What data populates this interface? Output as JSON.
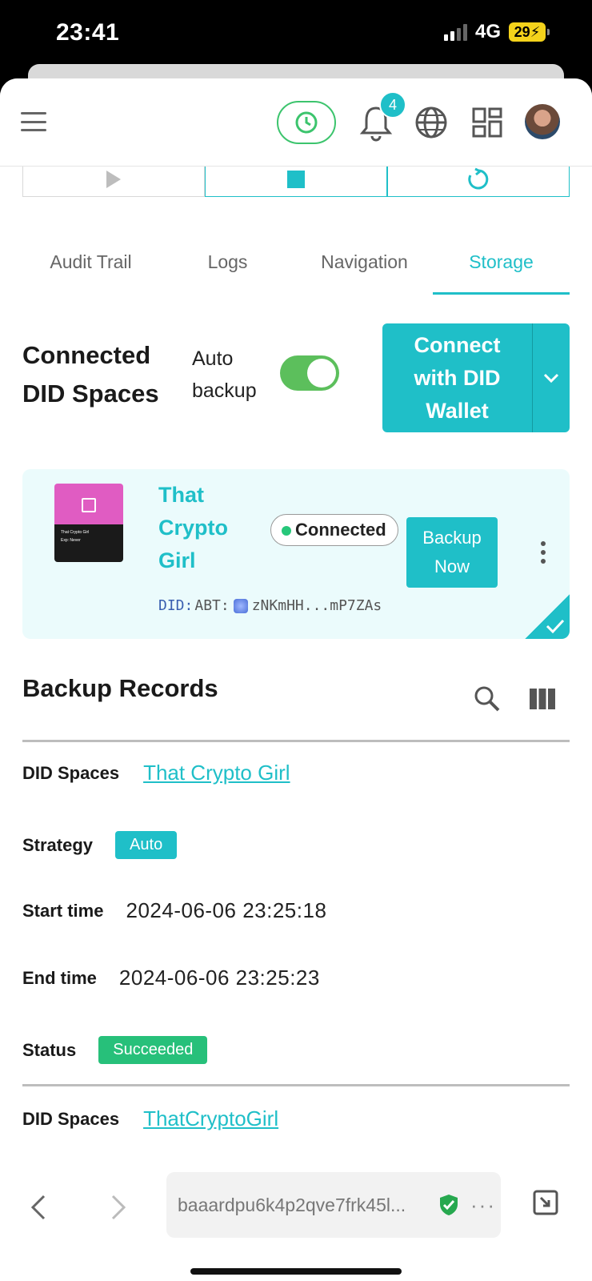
{
  "status_bar": {
    "time": "23:41",
    "network": "4G",
    "battery": "29"
  },
  "app_bar": {
    "notification_count": "4"
  },
  "tabs": [
    {
      "label": "Audit Trail",
      "active": false
    },
    {
      "label": "Logs",
      "active": false
    },
    {
      "label": "Navigation",
      "active": false
    },
    {
      "label": "Storage",
      "active": true
    }
  ],
  "storage": {
    "heading": "Connected DID Spaces",
    "auto_backup_label": "Auto backup",
    "auto_backup_on": true,
    "connect_button": "Connect with DID Wallet"
  },
  "space_card": {
    "name": "That Crypto Girl",
    "status": "Connected",
    "backup_button": "Backup Now",
    "did_prefix": "DID:",
    "did_type": "ABT:",
    "did_value": "zNKmHH...mP7ZAs",
    "thumb_title": "That Crypto Girl",
    "thumb_exp": "Exp: Never"
  },
  "records": {
    "title": "Backup Records",
    "labels": {
      "did_spaces": "DID Spaces",
      "strategy": "Strategy",
      "start_time": "Start time",
      "end_time": "End time",
      "status": "Status"
    },
    "items": [
      {
        "did_spaces": "That Crypto Girl",
        "strategy": "Auto",
        "start_time": "2024-06-06 23:25:18",
        "end_time": "2024-06-06 23:25:23",
        "status": "Succeeded"
      },
      {
        "did_spaces": "ThatCryptoGirl"
      }
    ]
  },
  "browser": {
    "url": "baaardpu6k4p2qve7frk45l...",
    "more": "···"
  },
  "colors": {
    "accent": "#1fbfc8",
    "success": "#27c07a",
    "toggle_on": "#5cbf5c"
  }
}
